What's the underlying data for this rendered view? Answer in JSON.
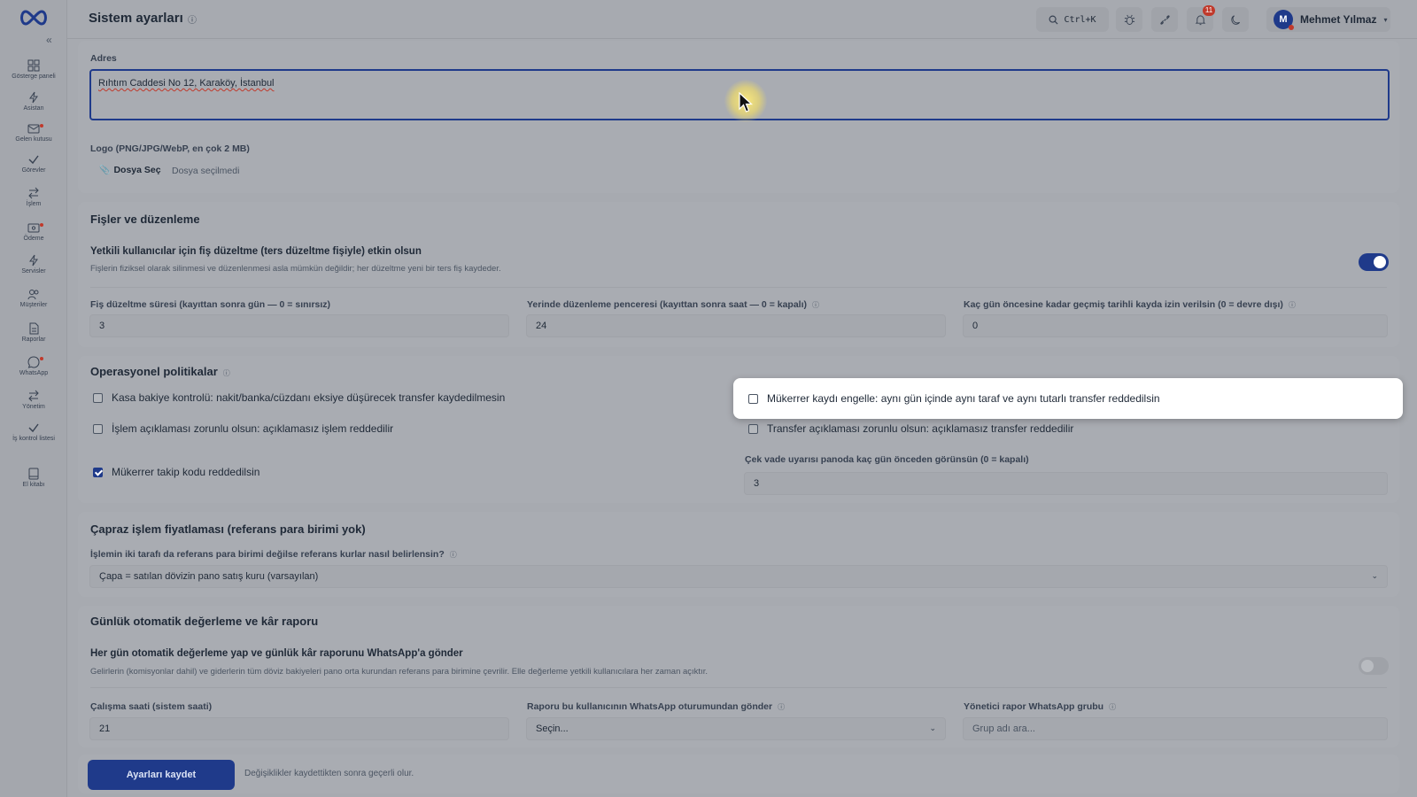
{
  "app": {
    "title": "Sistem ayarları",
    "title_info": "ⓘ"
  },
  "sidebar": {
    "items": [
      {
        "label": "Gösterge paneli"
      },
      {
        "label": "Asistan"
      },
      {
        "label": "Gelen kutusu"
      },
      {
        "label": "Görevler"
      },
      {
        "label": "İşlem"
      },
      {
        "label": "Ödeme"
      },
      {
        "label": "Servisler"
      },
      {
        "label": "Müşteriler"
      },
      {
        "label": "Raporlar"
      },
      {
        "label": "WhatsApp"
      },
      {
        "label": "Yönetim"
      },
      {
        "label": "İş kontrol listesi"
      },
      {
        "label": "El kitabı"
      }
    ]
  },
  "header": {
    "search_shortcut": "Ctrl+K",
    "notifications_count": "11",
    "user": {
      "initial": "M",
      "name": "Mehmet Yılmaz"
    }
  },
  "general": {
    "address_label": "Adres",
    "address_value": "Rıhtım Caddesi No 12, Karaköy, İstanbul",
    "logo_label": "Logo (PNG/JPG/WebP, en çok 2 MB)",
    "file_button": "Dosya Seç",
    "file_status": "Dosya seçilmedi"
  },
  "receipts": {
    "title": "Fişler ve düzenleme",
    "toggle_title": "Yetkili kullanıcılar için fiş düzeltme (ters düzeltme fişiyle) etkin olsun",
    "toggle_desc": "Fişlerin fiziksel olarak silinmesi ve düzenlenmesi asla mümkün değildir; her düzeltme yeni bir ters fiş kaydeder.",
    "toggle_on": true,
    "field1_label": "Fiş düzeltme süresi (kayıttan sonra gün — 0 = sınırsız)",
    "field1_value": "3",
    "field2_label": "Yerinde düzenleme penceresi (kayıttan sonra saat — 0 = kapalı)",
    "field2_value": "24",
    "field3_label": "Kaç gün öncesine kadar geçmiş tarihli kayda izin verilsin (0 = devre dışı)",
    "field3_value": "0"
  },
  "operations": {
    "title": "Operasyonel politikalar",
    "cb1": "Kasa bakiye kontrolü: nakit/banka/cüzdanı eksiye düşürecek transfer kaydedilmesin",
    "cb2": "İşlem açıklaması zorunlu olsun: açıklamasız işlem reddedilir",
    "cb3": "Mükerrer takip kodu reddedilsin",
    "cb4": "Mükerrer kaydı engelle: aynı gün içinde aynı taraf ve aynı tutarlı transfer reddedilsin",
    "cb5": "Transfer açıklaması zorunlu olsun: açıklamasız transfer reddedilir",
    "cheque_label": "Çek vade uyarısı panoda kaç gün önceden görünsün (0 = kapalı)",
    "cheque_value": "3"
  },
  "cross": {
    "title": "Çapraz işlem fiyatlaması (referans para birimi yok)",
    "question": "İşlemin iki tarafı da referans para birimi değilse referans kurlar nasıl belirlensin?",
    "selected": "Çapa = satılan dövizin pano satış kuru (varsayılan)"
  },
  "daily": {
    "title": "Günlük otomatik değerleme ve kâr raporu",
    "toggle_title": "Her gün otomatik değerleme yap ve günlük kâr raporunu WhatsApp'a gönder",
    "toggle_desc": "Gelirlerin (komisyonlar dahil) ve giderlerin tüm döviz bakiyeleri pano orta kurundan referans para birimine çevrilir. Elle değerleme yetkili kullanıcılara her zaman açıktır.",
    "toggle_on": false,
    "hour_label": "Çalışma saati (sistem saati)",
    "hour_value": "21",
    "sender_label": "Raporu bu kullanıcının WhatsApp oturumundan gönder",
    "sender_value": "Seçin...",
    "group_label": "Yönetici rapor WhatsApp grubu",
    "group_placeholder": "Grup adı ara..."
  },
  "footer": {
    "save_label": "Ayarları kaydet",
    "save_note": "Değişiklikler kaydettikten sonra geçerli olur."
  },
  "colors": {
    "accent": "#1f3a8a",
    "badge": "#c0392b"
  }
}
